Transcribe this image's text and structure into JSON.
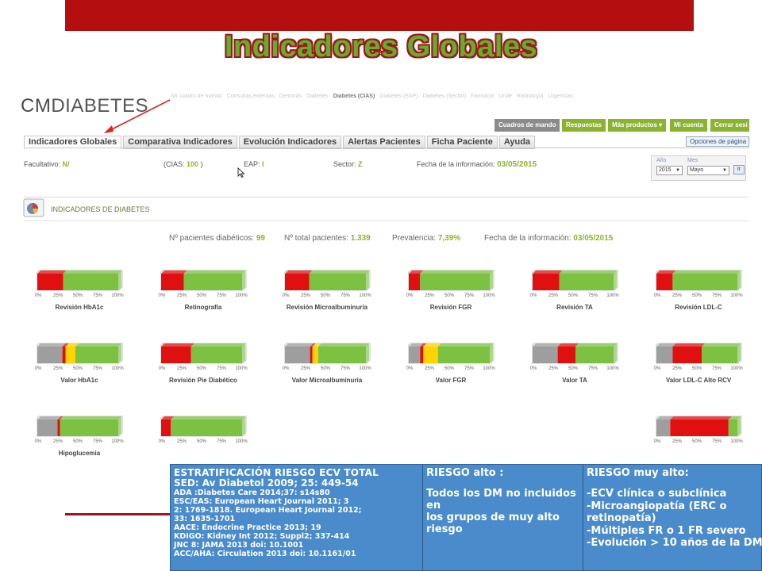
{
  "slide": {
    "title": "Indicadores Globales",
    "banner_color": "#b40e0e",
    "title_color": "#5fb12d",
    "title_outline": "#a5141b"
  },
  "app": {
    "logo_cm": "CM",
    "logo_rest": "DIABETES",
    "top_nav": [
      "Mi cuadro de mando",
      "Consultas externas",
      "Demoras",
      "Diabetes",
      "Diabetes (CIAS)",
      "Diabetes (EAP)",
      "Diabetes (Sector)",
      "Farmacia",
      "Urole",
      "Radiología",
      "Urgencias"
    ],
    "top_nav_active_index": 4,
    "buttons": [
      {
        "label": "Cuadros de mando",
        "color": "#8b8b8b"
      },
      {
        "label": "Respuestas",
        "color": "#8ab42e"
      },
      {
        "label": "Más productos",
        "color": "#8ab42e"
      },
      {
        "label": "Mi cuenta",
        "color": "#8ab42e"
      },
      {
        "label": "Cerrar sesi",
        "color": "#8ab42e"
      }
    ],
    "tabs": [
      "Indicadores Globales",
      "Comparativa Indicadores",
      "Evolución Indicadores",
      "Alertas Pacientes",
      "Ficha Paciente",
      "Ayuda"
    ],
    "active_tab": 0,
    "options_label": "Opciones de página"
  },
  "info": {
    "facultativo_label": "Facultativo:",
    "facultativo_value": "N/",
    "cias_label": "(CIAS:",
    "cias_value": "100",
    "cias_close": ")",
    "eap_label": "EAP:",
    "eap_value": "I",
    "sector_label": "Sector:",
    "sector_value": "Z",
    "fecha_label": "Fecha de la información:",
    "fecha_value": "03/05/2015"
  },
  "date_filter": {
    "year_label": "Año",
    "year_value": "2015",
    "month_label": "Mes",
    "month_value": "Mayo",
    "go_label": "Ir"
  },
  "section": {
    "title": "INDICADORES DE DIABETES"
  },
  "stats": {
    "diabeticos_label": "Nº pacientes diabéticos:",
    "diabeticos_value": "99",
    "total_label": "Nº total pacientes:",
    "total_value": "1.339",
    "prevalencia_label": "Prevalencia:",
    "prevalencia_value": "7,39%",
    "fecha_label": "Fecha de la información:",
    "fecha_value": "03/05/2015"
  },
  "tick_labels": [
    "0%",
    "25%",
    "50%",
    "75%",
    "100%"
  ],
  "colors": {
    "grey": "#9e9e9e",
    "red": "#e01010",
    "yellow": "#ffd400",
    "green": "#7cc142"
  },
  "gauges": [
    {
      "label": "Revisión HbA1c",
      "segments": [
        {
          "c": "red",
          "v": 32
        },
        {
          "c": "green",
          "v": 68
        }
      ]
    },
    {
      "label": "Retinografía",
      "segments": [
        {
          "c": "red",
          "v": 28
        },
        {
          "c": "green",
          "v": 72
        }
      ]
    },
    {
      "label": "Revisión Microalbuminuria",
      "segments": [
        {
          "c": "red",
          "v": 30
        },
        {
          "c": "green",
          "v": 70
        }
      ]
    },
    {
      "label": "Revisión FGR",
      "segments": [
        {
          "c": "red",
          "v": 14
        },
        {
          "c": "green",
          "v": 86
        }
      ]
    },
    {
      "label": "Revisión TA",
      "segments": [
        {
          "c": "red",
          "v": 33
        },
        {
          "c": "green",
          "v": 67
        }
      ]
    },
    {
      "label": "Revisión LDL-C",
      "segments": [
        {
          "c": "red",
          "v": 20
        },
        {
          "c": "green",
          "v": 80
        }
      ]
    },
    {
      "label": "Valor HbA1c",
      "segments": [
        {
          "c": "grey",
          "v": 31
        },
        {
          "c": "red",
          "v": 4
        },
        {
          "c": "yellow",
          "v": 12
        },
        {
          "c": "green",
          "v": 53
        }
      ]
    },
    {
      "label": "Revisión Pie Diabético",
      "segments": [
        {
          "c": "red",
          "v": 37
        },
        {
          "c": "green",
          "v": 63
        }
      ]
    },
    {
      "label": "Valor Microalbuminuria",
      "segments": [
        {
          "c": "grey",
          "v": 31
        },
        {
          "c": "red",
          "v": 3
        },
        {
          "c": "yellow",
          "v": 7
        },
        {
          "c": "green",
          "v": 59
        }
      ]
    },
    {
      "label": "Valor FGR",
      "segments": [
        {
          "c": "grey",
          "v": 14
        },
        {
          "c": "red",
          "v": 4
        },
        {
          "c": "yellow",
          "v": 18
        },
        {
          "c": "green",
          "v": 64
        }
      ]
    },
    {
      "label": "Valor TA",
      "segments": [
        {
          "c": "grey",
          "v": 31
        },
        {
          "c": "red",
          "v": 22
        },
        {
          "c": "green",
          "v": 47
        }
      ]
    },
    {
      "label": "Valor LDL-C Alto RCV",
      "segments": [
        {
          "c": "grey",
          "v": 20
        },
        {
          "c": "red",
          "v": 36
        },
        {
          "c": "green",
          "v": 44
        }
      ]
    },
    {
      "label": "Hipoglucemia",
      "segments": [
        {
          "c": "grey",
          "v": 25
        },
        {
          "c": "red",
          "v": 3
        },
        {
          "c": "green",
          "v": 72
        }
      ]
    },
    {
      "label": "",
      "segments": [
        {
          "c": "red",
          "v": 12
        },
        {
          "c": "green",
          "v": 88
        }
      ]
    },
    {
      "label": "",
      "segments": [
        {
          "c": "grey",
          "v": 17
        },
        {
          "c": "red",
          "v": 72
        },
        {
          "c": "green",
          "v": 11
        }
      ]
    }
  ],
  "risk_table": {
    "col1_title": "ESTRATIFICACIÓN RIESGO ECV TOTAL",
    "col1_lines": [
      {
        "text": "SED: Av Diabetol 2009; 25: 449-54",
        "big": true
      },
      {
        "text": "ADA :Diabetes Care 2014;37: s14s80",
        "big": false
      },
      {
        "text": "ESC/EAS: European Heart Journal 2011; 3",
        "big": false
      },
      {
        "text": "2: 1769-1818. European Heart Journal 2012;",
        "big": false
      },
      {
        "text": "33: 1635-1701",
        "big": false
      },
      {
        "text": "AACE: Endocrine Practice 2013; 19",
        "big": false
      },
      {
        "text": "KDIGO: Kidney Int 2012; Suppl2; 337-414",
        "big": false
      },
      {
        "text": "JNC 8: JAMA 2013 doi: 10.1001",
        "big": false
      },
      {
        "text": "ACC/AHA: Circulation 2013 doi: 10.1161/01",
        "big": false
      }
    ],
    "col2_title": "RIESGO alto :",
    "col2_body": [
      "Todos los DM no incluidos en",
      "los grupos de muy alto",
      "riesgo"
    ],
    "col3_title": "RIESGO muy alto:",
    "col3_body": [
      "-ECV clínica o subclínica",
      "-Microangiopatía (ERC o",
      "retinopatía)",
      "-Múltiples FR o 1 FR severo",
      "-Evolución > 10 años de la DM"
    ]
  }
}
